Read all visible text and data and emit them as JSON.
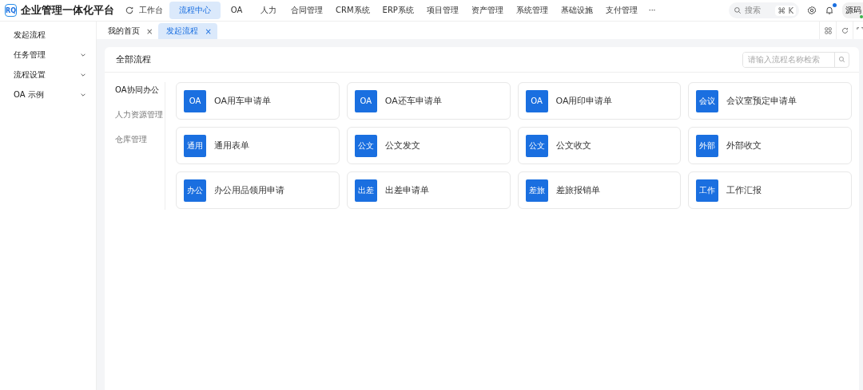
{
  "app": {
    "logo": "RQ",
    "title": "企业管理一体化平台"
  },
  "nav": [
    {
      "label": "工作台",
      "selected": false
    },
    {
      "label": "流程中心",
      "selected": true
    },
    {
      "label": "OA",
      "selected": false
    },
    {
      "label": "人力",
      "selected": false
    },
    {
      "label": "合同管理",
      "selected": false
    },
    {
      "label": "CRM系统",
      "selected": false
    },
    {
      "label": "ERP系统",
      "selected": false
    },
    {
      "label": "项目管理",
      "selected": false
    },
    {
      "label": "资产管理",
      "selected": false
    },
    {
      "label": "系统管理",
      "selected": false
    },
    {
      "label": "基础设施",
      "selected": false
    },
    {
      "label": "支付管理",
      "selected": false
    }
  ],
  "more": "···",
  "search": {
    "placeholder": "搜索",
    "shortcut": "⌘ K"
  },
  "notifications": {
    "unread": true
  },
  "user": {
    "name": "源码",
    "online": true
  },
  "sidebar": [
    {
      "label": "发起流程",
      "expandable": false
    },
    {
      "label": "任务管理",
      "expandable": true
    },
    {
      "label": "流程设置",
      "expandable": true
    },
    {
      "label": "OA 示例",
      "expandable": true
    }
  ],
  "tabs": [
    {
      "label": "我的首页",
      "selected": false,
      "close": "×"
    },
    {
      "label": "发起流程",
      "selected": true,
      "close": "×"
    }
  ],
  "panel": {
    "title": "全部流程",
    "search_placeholder": "请输入流程名称检索",
    "categories": [
      {
        "label": "OA协同办公",
        "selected": true
      },
      {
        "label": "人力资源管理",
        "selected": false
      },
      {
        "label": "仓库管理",
        "selected": false
      }
    ],
    "processes": [
      {
        "badge": "OA",
        "name": "OA用车申请单"
      },
      {
        "badge": "OA",
        "name": "OA还车申请单"
      },
      {
        "badge": "OA",
        "name": "OA用印申请单"
      },
      {
        "badge": "会议",
        "name": "会议室预定申请单"
      },
      {
        "badge": "通用",
        "name": "通用表单"
      },
      {
        "badge": "公文",
        "name": "公文发文"
      },
      {
        "badge": "公文",
        "name": "公文收文"
      },
      {
        "badge": "外部",
        "name": "外部收文"
      },
      {
        "badge": "办公",
        "name": "办公用品领用申请"
      },
      {
        "badge": "出差",
        "name": "出差申请单"
      },
      {
        "badge": "差旅",
        "name": "差旅报销单"
      },
      {
        "badge": "工作",
        "name": "工作汇报"
      }
    ]
  }
}
